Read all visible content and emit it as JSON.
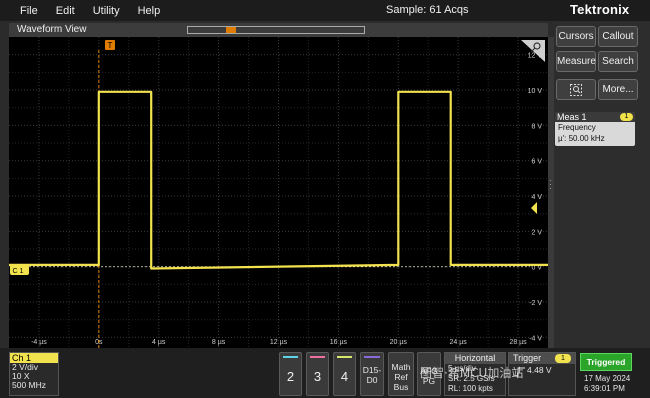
{
  "menu": {
    "items": [
      "File",
      "Edit",
      "Utility",
      "Help"
    ],
    "status": "Sample: 61 Acqs",
    "brand": "Tektronix"
  },
  "waveform_view": {
    "title": "Waveform View",
    "trigger_marker": "T"
  },
  "y_axis_labels": [
    "12 V",
    "10 V",
    "8 V",
    "6 V",
    "4 V",
    "2 V",
    "0 V",
    "-2 V",
    "-4 V"
  ],
  "x_axis_labels": [
    "-4 µs",
    "0s",
    "4 µs",
    "8 µs",
    "12 µs",
    "16 µs",
    "20 µs",
    "24 µs",
    "28 µs"
  ],
  "channel_marker": "C 1",
  "right_panel": {
    "cursors": "Cursors",
    "callout": "Callout",
    "measure": "Measure",
    "search": "Search",
    "more": "More...",
    "meas_title": "Meas 1",
    "meas_badge": "1",
    "meas_name": "Frequency",
    "meas_value": "µ': 50.00 kHz"
  },
  "ch1_panel": {
    "title": "Ch 1",
    "line1": "2 V/div",
    "line2": "10 X",
    "line3": "500 MHz"
  },
  "channel_buttons": [
    {
      "label": "2",
      "color": "#5fd3e8"
    },
    {
      "label": "3",
      "color": "#f06fa0"
    },
    {
      "label": "4",
      "color": "#d8e86a"
    }
  ],
  "bottom_buttons": {
    "d15": [
      "D15-",
      "D0"
    ],
    "math": [
      "Math",
      "Ref",
      "Bus"
    ],
    "afg": [
      "AFG",
      "PG"
    ]
  },
  "horizontal": {
    "title": "Horizontal",
    "line1": "5 µs/div",
    "line2": "SR: 2.5 GS/s",
    "line3": "RL: 100 kpts"
  },
  "trigger": {
    "title": "Trigger",
    "badge": "1",
    "level": "4.48 V"
  },
  "trigger_state": "Triggered",
  "datetime": {
    "date": "17 May 2024",
    "time": "6:39:01 PM"
  },
  "watermark": "图智·希MCU加油站",
  "chart_data": {
    "type": "line",
    "x_unit": "µs",
    "y_unit": "V",
    "xlim": [
      -6,
      30
    ],
    "ylim": [
      -4.6,
      13
    ],
    "series": [
      {
        "values": [
          [
            -6,
            0.1
          ],
          [
            0,
            0.1
          ],
          [
            0,
            9.9
          ],
          [
            3.5,
            9.9
          ],
          [
            3.5,
            -0.1
          ],
          [
            20,
            0.1
          ],
          [
            20,
            9.9
          ],
          [
            23.5,
            9.9
          ],
          [
            23.5,
            0.1
          ],
          [
            30,
            0.1
          ]
        ]
      }
    ],
    "grid": true,
    "color": "#f2e24d"
  }
}
